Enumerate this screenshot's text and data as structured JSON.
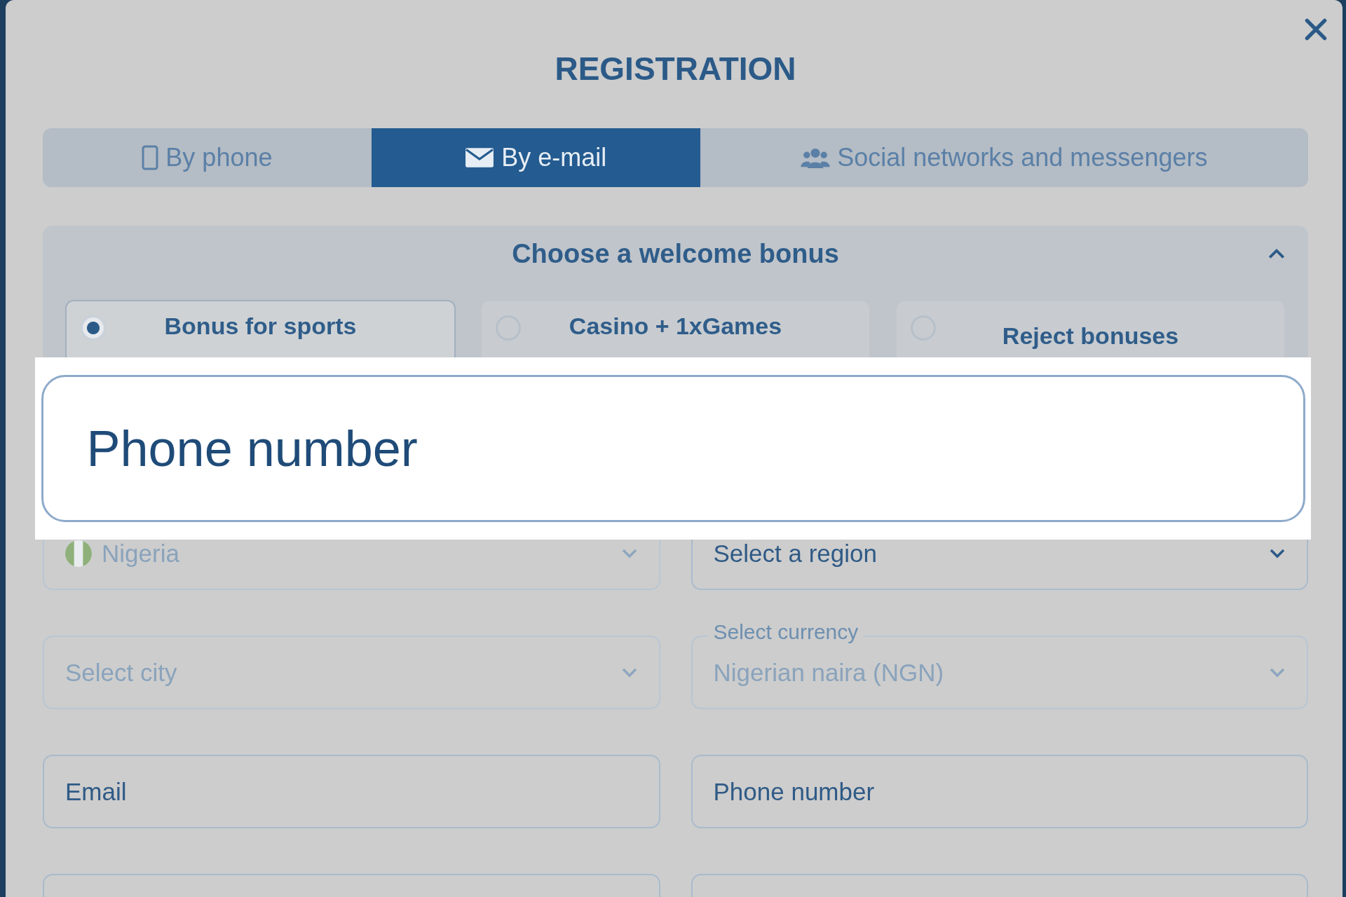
{
  "dialog": {
    "title": "REGISTRATION"
  },
  "tabs": [
    {
      "label": "By phone",
      "kind": "phone",
      "selected": false
    },
    {
      "label": "By e-mail",
      "kind": "email",
      "selected": true
    },
    {
      "label": "Social networks and messengers",
      "kind": "social",
      "selected": false
    }
  ],
  "bonus": {
    "title": "Choose a welcome bonus",
    "expanded": true,
    "options": [
      {
        "label": "Bonus for sports",
        "selected": true
      },
      {
        "label": "Casino + 1xGames",
        "selected": false
      },
      {
        "label": "Reject bonuses",
        "selected": false
      }
    ]
  },
  "fields": [
    {
      "kind": "country",
      "value": "Nigeria",
      "disabled": true
    },
    {
      "kind": "select",
      "placeholder": "Select a region",
      "disabled": false
    },
    {
      "kind": "select",
      "placeholder": "Select city",
      "disabled": true
    },
    {
      "kind": "select",
      "label": "Select currency",
      "value": "Nigerian naira (NGN)",
      "disabled": true
    },
    {
      "kind": "text",
      "placeholder": "Email",
      "disabled": false
    },
    {
      "kind": "text",
      "placeholder": "Phone number",
      "disabled": false
    },
    {
      "kind": "text",
      "disabled": false
    },
    {
      "kind": "text",
      "disabled": false
    }
  ],
  "callout": {
    "text": "Phone number"
  }
}
